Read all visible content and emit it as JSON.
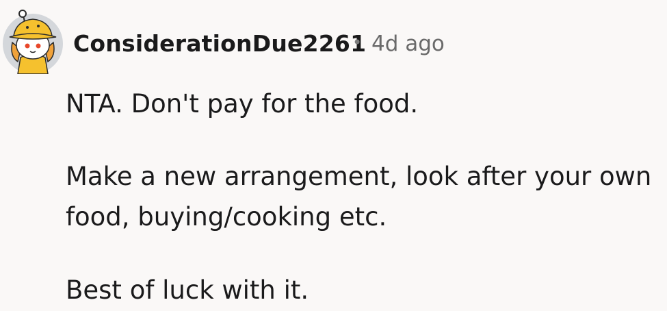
{
  "comment": {
    "author": "ConsiderationDue2261",
    "separator": "•",
    "time_ago": "4d ago",
    "avatar_icon": "snoo-avatar-icon",
    "paragraphs": [
      "NTA. Don't pay for the food.",
      "Make a new arrangement, look after your own",
      "food, buying/cooking etc.",
      "Best of luck with it."
    ]
  },
  "colors": {
    "background": "#faf8f7",
    "text": "#1a1a1b",
    "meta": "#6a6a6a",
    "avatar_bg": "#d4d7db",
    "hat_yellow": "#f5c12e"
  }
}
